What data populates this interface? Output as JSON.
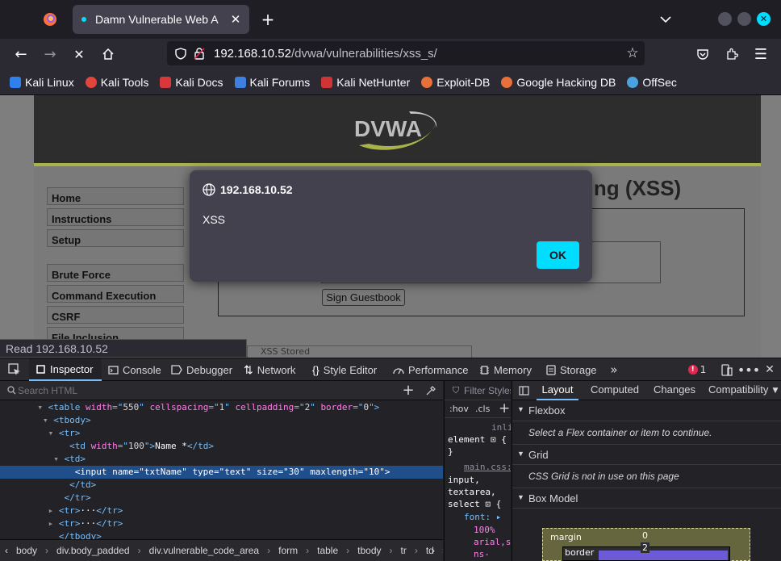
{
  "browser": {
    "tab_title": "Damn Vulnerable Web App (DVWA)",
    "url_host": "192.168.10.52",
    "url_path": "/dvwa/vulnerabilities/xss_s/",
    "bookmarks": [
      {
        "label": "Kali Linux",
        "color": "#2f80ed"
      },
      {
        "label": "Kali Tools",
        "color": "#e0463c"
      },
      {
        "label": "Kali Docs",
        "color": "#d8383a"
      },
      {
        "label": "Kali Forums",
        "color": "#3f7fe0"
      },
      {
        "label": "Kali NetHunter",
        "color": "#d03434"
      },
      {
        "label": "Exploit-DB",
        "color": "#e8703a"
      },
      {
        "label": "Google Hacking DB",
        "color": "#e8703a"
      },
      {
        "label": "OffSec",
        "color": "#4aa3df"
      }
    ]
  },
  "page": {
    "logo": "DVWA",
    "heading": "ting (XSS)",
    "menu": [
      "Home",
      "Instructions",
      "Setup",
      "Brute Force",
      "Command Execution",
      "CSRF",
      "File Inclusion"
    ],
    "sign_button": "Sign Guestbook",
    "source_partial": "XSS Stored"
  },
  "dialog": {
    "origin": "192.168.10.52",
    "message": "XSS",
    "ok": "OK"
  },
  "status_text": "Read 192.168.10.52",
  "devtools": {
    "tabs": [
      "Inspector",
      "Console",
      "Debugger",
      "Network",
      "Style Editor",
      "Performance",
      "Memory",
      "Storage"
    ],
    "error_count": "1",
    "search_placeholder": "Search HTML",
    "html_lines": [
      {
        "indent": 7,
        "arrow": "▾",
        "parts": [
          [
            "tg",
            "<table "
          ],
          [
            "an",
            "width"
          ],
          [
            "tg",
            "=\""
          ],
          [
            "av",
            "550"
          ],
          [
            "tg",
            "\" "
          ],
          [
            "an",
            "cellspacing"
          ],
          [
            "tg",
            "=\""
          ],
          [
            "av",
            "1"
          ],
          [
            "tg",
            "\" "
          ],
          [
            "an",
            "cellpadding"
          ],
          [
            "tg",
            "=\""
          ],
          [
            "av",
            "2"
          ],
          [
            "tg",
            "\" "
          ],
          [
            "an",
            "border"
          ],
          [
            "tg",
            "=\""
          ],
          [
            "av",
            "0"
          ],
          [
            "tg",
            "\">"
          ]
        ]
      },
      {
        "indent": 8,
        "arrow": "▾",
        "parts": [
          [
            "tg",
            "<tbody>"
          ]
        ]
      },
      {
        "indent": 9,
        "arrow": "▾",
        "parts": [
          [
            "tg",
            "<tr>"
          ]
        ]
      },
      {
        "indent": 11,
        "arrow": "",
        "parts": [
          [
            "tg",
            "<td "
          ],
          [
            "an",
            "width"
          ],
          [
            "tg",
            "=\""
          ],
          [
            "av",
            "100"
          ],
          [
            "tg",
            "\">"
          ],
          [
            "tx",
            "Name *"
          ],
          [
            "tg",
            "</td>"
          ]
        ]
      },
      {
        "indent": 10,
        "arrow": "▾",
        "parts": [
          [
            "tg",
            "<td>"
          ]
        ]
      },
      {
        "indent": 12,
        "arrow": "",
        "parts": [
          [
            "tg",
            "<input "
          ],
          [
            "an",
            "name"
          ],
          [
            "tg",
            "=\""
          ],
          [
            "av",
            "txtName"
          ],
          [
            "tg",
            "\" "
          ],
          [
            "an",
            "type"
          ],
          [
            "tg",
            "=\""
          ],
          [
            "av",
            "text"
          ],
          [
            "tg",
            "\" "
          ],
          [
            "an",
            "size"
          ],
          [
            "tg",
            "=\""
          ],
          [
            "av",
            "30"
          ],
          [
            "tg",
            "\" "
          ],
          [
            "an",
            "maxlength"
          ],
          [
            "tg",
            "=\""
          ],
          [
            "av",
            "10"
          ],
          [
            "tg",
            "\">"
          ]
        ]
      },
      {
        "indent": 11,
        "arrow": "",
        "parts": [
          [
            "tg",
            "</td>"
          ]
        ]
      },
      {
        "indent": 10,
        "arrow": "",
        "parts": [
          [
            "tg",
            "</tr>"
          ]
        ]
      },
      {
        "indent": 9,
        "arrow": "▸",
        "parts": [
          [
            "tg",
            "<tr>"
          ],
          [
            "tx",
            "···"
          ],
          [
            "tg",
            "</tr>"
          ]
        ]
      },
      {
        "indent": 9,
        "arrow": "▸",
        "parts": [
          [
            "tg",
            "<tr>"
          ],
          [
            "tx",
            "···"
          ],
          [
            "tg",
            "</tr>"
          ]
        ]
      },
      {
        "indent": 9,
        "arrow": "",
        "parts": [
          [
            "tg",
            "</tbody>"
          ]
        ]
      }
    ],
    "breadcrumbs": [
      "body",
      "div.body_padded",
      "div.vulnerable_code_area",
      "form",
      "table",
      "tbody",
      "tr",
      "td",
      "input"
    ],
    "rules": {
      "filter_placeholder": "Filter Styles",
      "hov": ":hov",
      "cls": ".cls",
      "inline": "inli",
      "element": "element",
      "brace_close": "}",
      "source": "main.css:",
      "selector1": "input,",
      "selector2": "textarea,",
      "selector3": "select",
      "prop": "font:",
      "val1": "100%",
      "val2": "arial,s",
      "val3": "ns-"
    },
    "layout_tabs": [
      "Layout",
      "Computed",
      "Changes",
      "Compatibility"
    ],
    "flexbox_title": "Flexbox",
    "flexbox_note": "Select a Flex container or item to continue.",
    "grid_title": "Grid",
    "grid_note": "CSS Grid is not in use on this page",
    "box_model_title": "Box Model",
    "margin_label": "margin",
    "margin_value": "0",
    "border_label": "border",
    "border_value": "2"
  }
}
